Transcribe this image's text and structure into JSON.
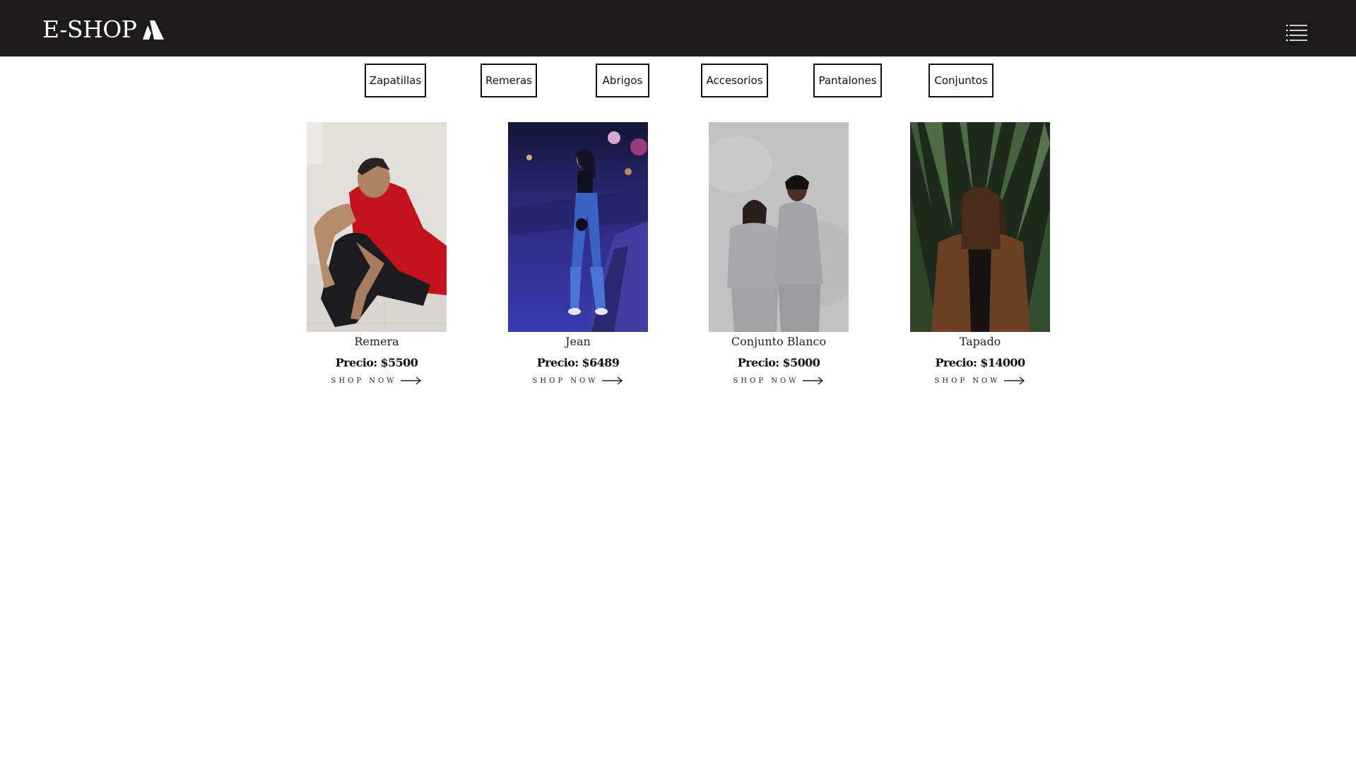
{
  "header": {
    "brand": "E-SHOP",
    "logo_icon": "triangle-logo-icon",
    "menu_icon": "list-menu-icon",
    "background": "#1c1a1b"
  },
  "categories": [
    {
      "label": "Zapatillas"
    },
    {
      "label": "Remeras"
    },
    {
      "label": "Abrigos"
    },
    {
      "label": "Accesorios"
    },
    {
      "label": "Pantalones"
    },
    {
      "label": "Conjuntos"
    }
  ],
  "products": [
    {
      "name": "Remera",
      "price": "Precio: $5500",
      "cta": "SHOP NOW",
      "photo": "man-in-red-shirt-sitting-photo"
    },
    {
      "name": "Jean",
      "price": "Precio: $6489",
      "cta": "SHOP NOW",
      "photo": "woman-in-jeans-night-street-photo"
    },
    {
      "name": "Conjunto Blanco",
      "price": "Precio: $5000",
      "cta": "SHOP NOW",
      "photo": "couple-in-grey-tracksuits-photo"
    },
    {
      "name": "Tapado",
      "price": "Precio: $14000",
      "cta": "SHOP NOW",
      "photo": "woman-in-brown-coat-plants-photo"
    }
  ]
}
